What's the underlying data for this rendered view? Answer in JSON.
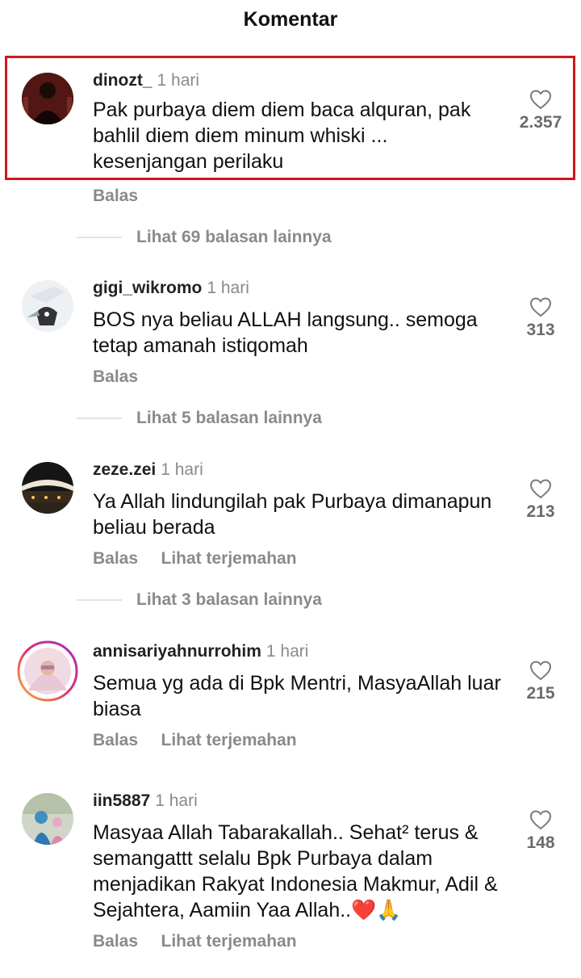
{
  "header": {
    "title": "Komentar"
  },
  "ui": {
    "reply_label": "Balas",
    "translate_label": "Lihat terjemahan"
  },
  "colors": {
    "highlight": "#d0161d",
    "muted": "#8a8a8a"
  },
  "comments": [
    {
      "username": "dinozt_",
      "time": "1 hari",
      "text": "Pak purbaya diem diem baca alquran, pak bahlil diem diem minum whiski ... kesenjangan perilaku",
      "likes": "2.357",
      "replies_label": "Lihat 69 balasan lainnya",
      "highlighted": true
    },
    {
      "username": "gigi_wikromo",
      "time": "1 hari",
      "text": "BOS nya beliau ALLAH langsung.. semoga tetap amanah istiqomah",
      "likes": "313",
      "replies_label": "Lihat 5 balasan lainnya"
    },
    {
      "username": "zeze.zei",
      "time": "1 hari",
      "text": "Ya Allah lindungilah pak Purbaya dimanapun beliau berada",
      "likes": "213",
      "replies_label": "Lihat 3 balasan lainnya"
    },
    {
      "username": "annisariyahnurrohim",
      "time": "1 hari",
      "text": "Semua yg ada di Bpk Mentri, MasyaAllah luar biasa",
      "likes": "215"
    },
    {
      "username": "iin5887",
      "time": "1 hari",
      "text": "Masyaa Allah Tabarakallah.. Sehat² terus & semangattt selalu Bpk Purbaya dalam menjadikan Rakyat Indonesia Makmur, Adil & Sejahtera, Aamiin Yaa Allah..❤️🙏",
      "likes": "148"
    }
  ]
}
